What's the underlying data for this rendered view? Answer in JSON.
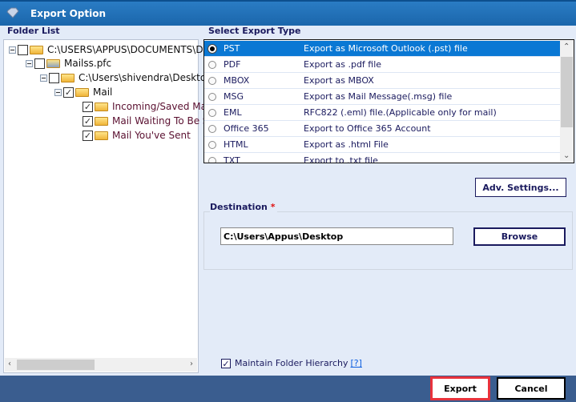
{
  "window": {
    "title": "Export Option"
  },
  "folder_list": {
    "label": "Folder List",
    "nodes": [
      {
        "label": "C:\\USERS\\APPUS\\DOCUMENTS\\DC",
        "checked": false
      },
      {
        "label": "Mailss.pfc",
        "checked": false
      },
      {
        "label": "C:\\Users\\shivendra\\Desktop",
        "checked": false
      },
      {
        "label": "Mail",
        "checked": true
      },
      {
        "label": "Incoming/Saved Mai",
        "checked": true
      },
      {
        "label": "Mail Waiting To Be S",
        "checked": true
      },
      {
        "label": "Mail You've Sent",
        "checked": true
      }
    ]
  },
  "export_type": {
    "label": "Select Export Type",
    "selected": "PST",
    "options": [
      {
        "name": "PST",
        "desc": "Export as Microsoft Outlook (.pst) file"
      },
      {
        "name": "PDF",
        "desc": "Export as .pdf file"
      },
      {
        "name": "MBOX",
        "desc": "Export as MBOX"
      },
      {
        "name": "MSG",
        "desc": "Export as Mail Message(.msg) file"
      },
      {
        "name": "EML",
        "desc": "RFC822 (.eml) file.(Applicable only for mail)"
      },
      {
        "name": "Office 365",
        "desc": "Export to Office 365 Account"
      },
      {
        "name": "HTML",
        "desc": "Export as .html File"
      },
      {
        "name": "TXT",
        "desc": "Export to .txt file"
      }
    ]
  },
  "adv_settings_label": "Adv. Settings...",
  "destination": {
    "label": "Destination",
    "required_mark": "*",
    "value": "C:\\Users\\Appus\\Desktop",
    "browse_label": "Browse"
  },
  "maintain_hierarchy": {
    "label": "Maintain Folder Hierarchy",
    "help": "[?]",
    "checked": true
  },
  "footer": {
    "export_label": "Export",
    "cancel_label": "Cancel"
  }
}
